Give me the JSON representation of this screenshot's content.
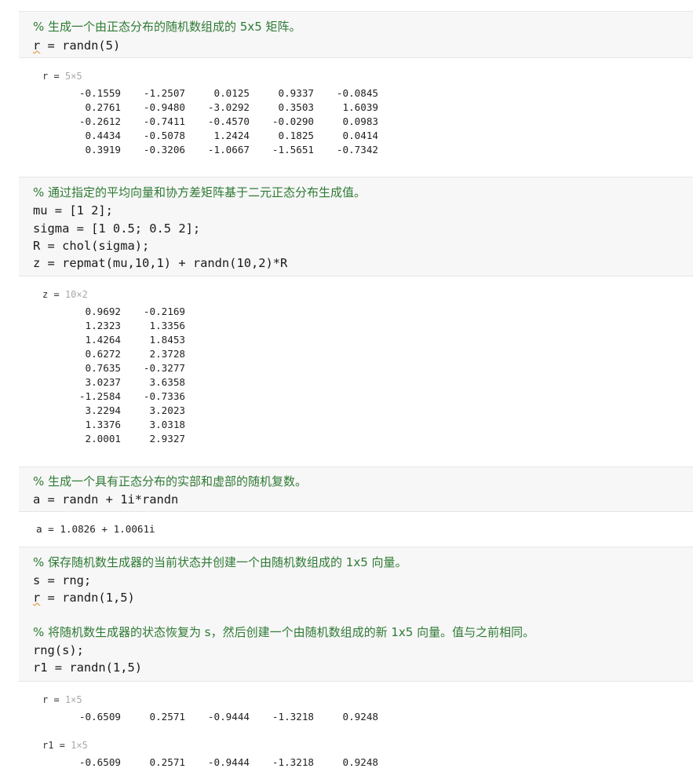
{
  "cells": [
    {
      "lines": [
        {
          "text": "% 生成一个由正态分布的随机数组成的 5x5 矩阵。",
          "comment": true
        },
        {
          "var": "r",
          "rest": " = randn(5)",
          "squiggle": true
        }
      ],
      "output": {
        "type": "matrix",
        "name": "r",
        "dims": "5×5",
        "rows": [
          [
            "-0.1559",
            "-1.2507",
            "0.0125",
            "0.9337",
            "-0.0845"
          ],
          [
            "0.2761",
            "-0.9480",
            "-3.0292",
            "0.3503",
            "1.6039"
          ],
          [
            "-0.2612",
            "-0.7411",
            "-0.4570",
            "-0.0290",
            "0.0983"
          ],
          [
            "0.4434",
            "-0.5078",
            "1.2424",
            "0.1825",
            "0.0414"
          ],
          [
            "0.3919",
            "-0.3206",
            "-1.0667",
            "-1.5651",
            "-0.7342"
          ]
        ]
      }
    },
    {
      "lines": [
        {
          "text": "% 通过指定的平均向量和协方差矩阵基于二元正态分布生成值。",
          "comment": true
        },
        {
          "text": "mu = [1 2];"
        },
        {
          "text": "sigma = [1 0.5; 0.5 2];"
        },
        {
          "text": "R = chol(sigma);"
        },
        {
          "text": "z = repmat(mu,10,1) + randn(10,2)*R"
        }
      ],
      "output": {
        "type": "matrix",
        "name": "z",
        "dims": "10×2",
        "rows": [
          [
            "0.9692",
            "-0.2169"
          ],
          [
            "1.2323",
            "1.3356"
          ],
          [
            "1.4264",
            "1.8453"
          ],
          [
            "0.6272",
            "2.3728"
          ],
          [
            "0.7635",
            "-0.3277"
          ],
          [
            "3.0237",
            "3.6358"
          ],
          [
            "-1.2584",
            "-0.7336"
          ],
          [
            "3.2294",
            "3.2023"
          ],
          [
            "1.3376",
            "3.0318"
          ],
          [
            "2.0001",
            "2.9327"
          ]
        ]
      }
    },
    {
      "lines": [
        {
          "text": "% 生成一个具有正态分布的实部和虚部的随机复数。",
          "comment": true
        },
        {
          "text": "a = randn + 1i*randn"
        }
      ],
      "output": {
        "type": "scalar",
        "text": "a = 1.0826 + 1.0061i"
      }
    },
    {
      "lines": [
        {
          "text": "% 保存随机数生成器的当前状态并创建一个由随机数组成的 1x5 向量。",
          "comment": true
        },
        {
          "text": "s = rng;"
        },
        {
          "var": "r",
          "rest": " = randn(1,5)",
          "squiggle": true
        },
        {
          "text": ""
        },
        {
          "text": "% 将随机数生成器的状态恢复为 s，然后创建一个由随机数组成的新 1x5 向量。值与之前相同。",
          "comment": true
        },
        {
          "text": "rng(s);"
        },
        {
          "text": "r1 = randn(1,5)"
        }
      ],
      "outputs": [
        {
          "type": "matrix",
          "name": "r",
          "dims": "1×5",
          "rows": [
            [
              "-0.6509",
              "0.2571",
              "-0.9444",
              "-1.3218",
              "0.9248"
            ]
          ]
        },
        {
          "type": "matrix",
          "name": "r1",
          "dims": "1×5",
          "rows": [
            [
              "-0.6509",
              "0.2571",
              "-0.9444",
              "-1.3218",
              "0.9248"
            ]
          ]
        }
      ]
    }
  ]
}
